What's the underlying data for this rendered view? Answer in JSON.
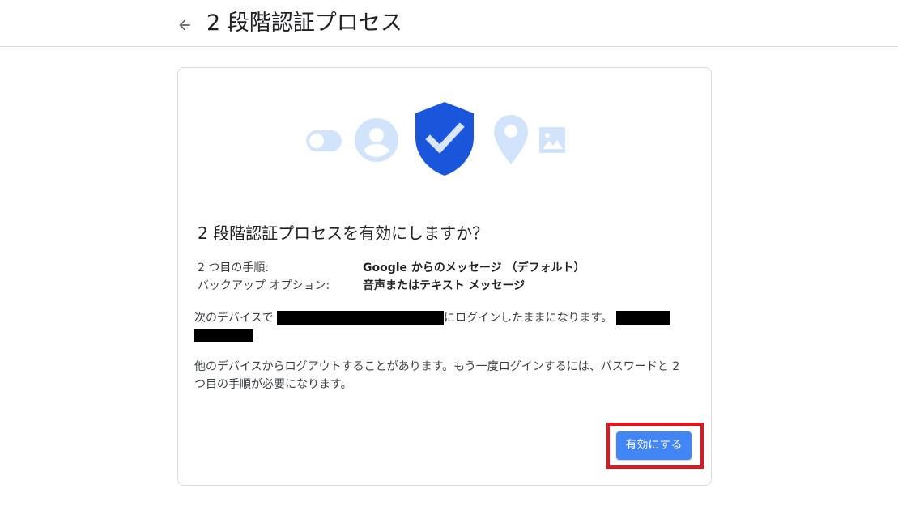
{
  "header": {
    "title": "2 段階認証プロセス",
    "back_icon": "arrow-back-icon"
  },
  "card": {
    "hero_icons": [
      "toggle-icon",
      "account-circle-icon",
      "shield-check-icon",
      "location-pin-icon",
      "image-icon"
    ],
    "heading": "2 段階認証プロセスを有効にしますか？",
    "info": [
      {
        "label": "2 つ目の手順:",
        "value": "Google からのメッセージ （デフォルト）"
      },
      {
        "label": "バックアップ オプション:",
        "value": "音声またはテキスト メッセージ"
      }
    ],
    "devices_text_before": "次のデバイスで",
    "devices_text_after": "にログインしたままになります。",
    "logout_notice": "他のデバイスからログアウトすることがあります。もう一度ログインするには、パスワードと 2 つ目の手順が必要になります。",
    "enable_button_label": "有効にする"
  },
  "colors": {
    "accent": "#4285f4",
    "shield": "#1a56db",
    "light_icon": "#d2e3fc",
    "highlight": "#e3161e"
  }
}
